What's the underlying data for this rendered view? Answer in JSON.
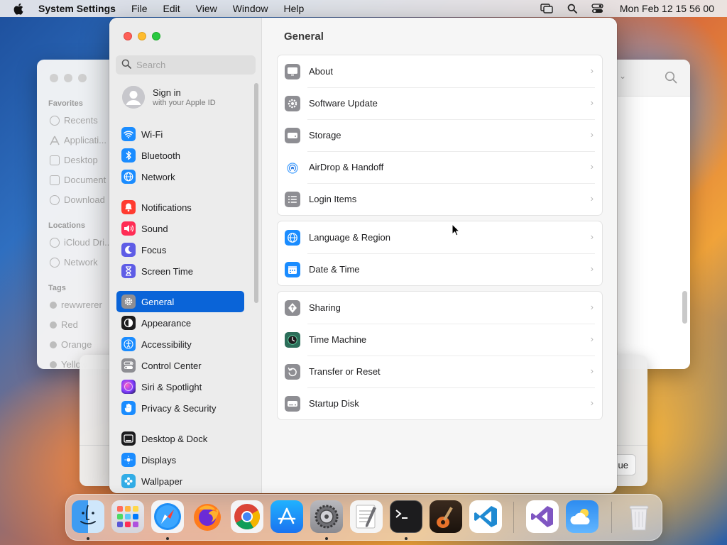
{
  "menubar": {
    "app_name": "System Settings",
    "menus": [
      "File",
      "Edit",
      "View",
      "Window",
      "Help"
    ],
    "clock": "Mon Feb 12  15 56 00"
  },
  "finder": {
    "sections": {
      "favorites": "Favorites",
      "locations": "Locations",
      "tags": "Tags"
    },
    "favorites": [
      "Recents",
      "Applicati...",
      "Desktop",
      "Document",
      "Download"
    ],
    "locations": [
      "iCloud Dri...",
      "Network"
    ],
    "tags": [
      "rewwrerer",
      "Red",
      "Orange",
      "Yellow"
    ]
  },
  "dialog": {
    "button_label": "ue"
  },
  "settings": {
    "search_placeholder": "Search",
    "signin": {
      "title": "Sign in",
      "subtitle": "with your Apple ID"
    },
    "sidebar": [
      {
        "label": "Wi-Fi",
        "icon": "wifi-icon",
        "color": "#1a8cff"
      },
      {
        "label": "Bluetooth",
        "icon": "bluetooth-icon",
        "color": "#1a8cff"
      },
      {
        "label": "Network",
        "icon": "globe-icon",
        "color": "#1a8cff"
      },
      {
        "label": "Notifications",
        "icon": "bell-icon",
        "color": "#ff3b30"
      },
      {
        "label": "Sound",
        "icon": "speaker-icon",
        "color": "#ff2d55"
      },
      {
        "label": "Focus",
        "icon": "moon-icon",
        "color": "#5e5ce6"
      },
      {
        "label": "Screen Time",
        "icon": "hourglass-icon",
        "color": "#5e5ce6"
      },
      {
        "label": "General",
        "icon": "gear-icon",
        "color": "#8e8e93",
        "selected": true
      },
      {
        "label": "Appearance",
        "icon": "appearance-icon",
        "color": "#1c1c1e"
      },
      {
        "label": "Accessibility",
        "icon": "accessibility-icon",
        "color": "#1a8cff"
      },
      {
        "label": "Control Center",
        "icon": "control-center-icon",
        "color": "#8e8e93"
      },
      {
        "label": "Siri & Spotlight",
        "icon": "siri-icon",
        "color": "#af52de"
      },
      {
        "label": "Privacy & Security",
        "icon": "hand-icon",
        "color": "#1a8cff"
      },
      {
        "label": "Desktop & Dock",
        "icon": "dock-icon",
        "color": "#1c1c1e"
      },
      {
        "label": "Displays",
        "icon": "display-icon",
        "color": "#1a8cff"
      },
      {
        "label": "Wallpaper",
        "icon": "wallpaper-icon",
        "color": "#32ade6"
      }
    ],
    "page_title": "General",
    "groups": [
      [
        {
          "label": "About",
          "icon": "monitor-icon"
        },
        {
          "label": "Software Update",
          "icon": "software-update-icon"
        },
        {
          "label": "Storage",
          "icon": "storage-icon"
        },
        {
          "label": "AirDrop & Handoff",
          "icon": "airdrop-icon"
        },
        {
          "label": "Login Items",
          "icon": "list-icon"
        }
      ],
      [
        {
          "label": "Language & Region",
          "icon": "globe-icon"
        },
        {
          "label": "Date & Time",
          "icon": "calendar-icon"
        }
      ],
      [
        {
          "label": "Sharing",
          "icon": "sharing-icon"
        },
        {
          "label": "Time Machine",
          "icon": "time-machine-icon"
        },
        {
          "label": "Transfer or Reset",
          "icon": "reset-icon"
        },
        {
          "label": "Startup Disk",
          "icon": "disk-icon"
        }
      ]
    ]
  },
  "dock": [
    {
      "name": "Finder",
      "running": true
    },
    {
      "name": "Launchpad",
      "running": false
    },
    {
      "name": "Safari",
      "running": true
    },
    {
      "name": "Firefox",
      "running": false
    },
    {
      "name": "Chrome",
      "running": false
    },
    {
      "name": "App Store",
      "running": false
    },
    {
      "name": "System Settings",
      "running": true
    },
    {
      "name": "TextEdit",
      "running": false
    },
    {
      "name": "Terminal",
      "running": true
    },
    {
      "name": "GarageBand",
      "running": false
    },
    {
      "name": "VS Code",
      "running": false
    },
    {
      "name": "Visual Studio",
      "running": false
    },
    {
      "name": "Weather",
      "running": false
    },
    {
      "name": "Trash",
      "running": false
    }
  ]
}
